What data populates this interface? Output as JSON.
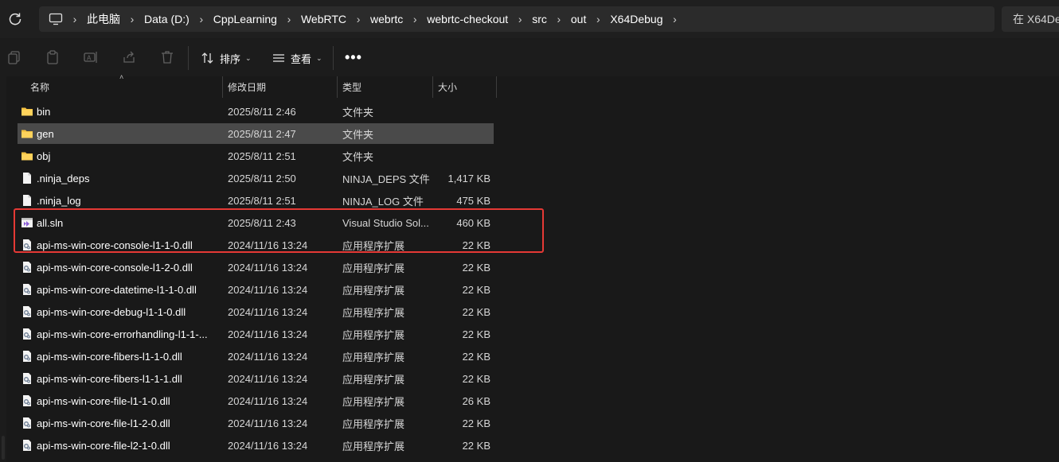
{
  "address": {
    "crumbs": [
      "此电脑",
      "Data (D:)",
      "CppLearning",
      "WebRTC",
      "webrtc",
      "webrtc-checkout",
      "src",
      "out",
      "X64Debug"
    ],
    "search_placeholder": "在 X64De"
  },
  "toolbar": {
    "sort_label": "排序",
    "view_label": "查看",
    "more_label": "•••",
    "icons": [
      "copy-icon",
      "paste-icon",
      "rename-icon",
      "share-icon",
      "delete-icon"
    ]
  },
  "columns": {
    "name": "名称",
    "date": "修改日期",
    "type": "类型",
    "size": "大小"
  },
  "files": [
    {
      "name": "bin",
      "date": "2025/8/11 2:46",
      "type": "文件夹",
      "size": "",
      "icon": "folder"
    },
    {
      "name": "gen",
      "date": "2025/8/11 2:47",
      "type": "文件夹",
      "size": "",
      "icon": "folder"
    },
    {
      "name": "obj",
      "date": "2025/8/11 2:51",
      "type": "文件夹",
      "size": "",
      "icon": "folder"
    },
    {
      "name": ".ninja_deps",
      "date": "2025/8/11 2:50",
      "type": "NINJA_DEPS 文件",
      "size": "1,417 KB",
      "icon": "file"
    },
    {
      "name": ".ninja_log",
      "date": "2025/8/11 2:51",
      "type": "NINJA_LOG 文件",
      "size": "475 KB",
      "icon": "file"
    },
    {
      "name": "all.sln",
      "date": "2025/8/11 2:43",
      "type": "Visual Studio Sol...",
      "size": "460 KB",
      "icon": "sln"
    },
    {
      "name": "api-ms-win-core-console-l1-1-0.dll",
      "date": "2024/11/16 13:24",
      "type": "应用程序扩展",
      "size": "22 KB",
      "icon": "dll"
    },
    {
      "name": "api-ms-win-core-console-l1-2-0.dll",
      "date": "2024/11/16 13:24",
      "type": "应用程序扩展",
      "size": "22 KB",
      "icon": "dll"
    },
    {
      "name": "api-ms-win-core-datetime-l1-1-0.dll",
      "date": "2024/11/16 13:24",
      "type": "应用程序扩展",
      "size": "22 KB",
      "icon": "dll"
    },
    {
      "name": "api-ms-win-core-debug-l1-1-0.dll",
      "date": "2024/11/16 13:24",
      "type": "应用程序扩展",
      "size": "22 KB",
      "icon": "dll"
    },
    {
      "name": "api-ms-win-core-errorhandling-l1-1-...",
      "date": "2024/11/16 13:24",
      "type": "应用程序扩展",
      "size": "22 KB",
      "icon": "dll"
    },
    {
      "name": "api-ms-win-core-fibers-l1-1-0.dll",
      "date": "2024/11/16 13:24",
      "type": "应用程序扩展",
      "size": "22 KB",
      "icon": "dll"
    },
    {
      "name": "api-ms-win-core-fibers-l1-1-1.dll",
      "date": "2024/11/16 13:24",
      "type": "应用程序扩展",
      "size": "22 KB",
      "icon": "dll"
    },
    {
      "name": "api-ms-win-core-file-l1-1-0.dll",
      "date": "2024/11/16 13:24",
      "type": "应用程序扩展",
      "size": "26 KB",
      "icon": "dll"
    },
    {
      "name": "api-ms-win-core-file-l1-2-0.dll",
      "date": "2024/11/16 13:24",
      "type": "应用程序扩展",
      "size": "22 KB",
      "icon": "dll"
    },
    {
      "name": "api-ms-win-core-file-l2-1-0.dll",
      "date": "2024/11/16 13:24",
      "type": "应用程序扩展",
      "size": "22 KB",
      "icon": "dll"
    }
  ],
  "selected_file": "gen",
  "highlighted_files": [
    "all.sln",
    "api-ms-win-core-console-l1-1-0.dll"
  ],
  "colors": {
    "background": "#191919",
    "selected_row": "#4a4a4a",
    "highlight_border": "#e53935",
    "folder": "#f5c242"
  }
}
